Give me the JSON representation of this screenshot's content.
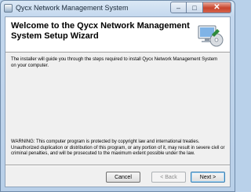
{
  "window": {
    "title": "Qycx Network Management System",
    "controls": {
      "minimize": "–",
      "maximize": "□",
      "close": "✕"
    }
  },
  "banner": {
    "heading": "Welcome to the Qycx Network Management System Setup Wizard",
    "icon": "setup-computer-icon"
  },
  "body": {
    "intro": "The installer will guide you through the steps required to install Qycx Network Management System on your computer.",
    "warning": "WARNING: This computer program is protected by copyright law and international treaties. Unauthorized duplication or distribution of this program, or any portion of it, may result in severe civil or criminal penalties, and will be prosecuted to the maximum extent possible under the law."
  },
  "buttons": {
    "cancel": "Cancel",
    "back": "< Back",
    "next": "Next >"
  }
}
